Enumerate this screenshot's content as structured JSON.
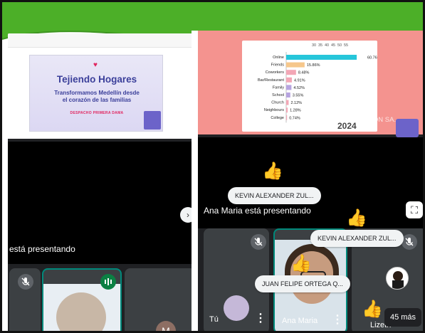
{
  "colors": {
    "banner_green": "#4caf28",
    "meet_dark": "#202124",
    "tile": "#3c4043",
    "active_border": "#00897b",
    "pink": "#f4938f",
    "chart_bar": "#26c6da"
  },
  "left_panel": {
    "slide": {
      "heart": "♥",
      "title": "Tejiendo Hogares",
      "subtitle_line1": "Transformamos Medellín desde",
      "subtitle_line2": "el corazón de las familias",
      "office": "DESPACHO PRIMERA DAMA"
    },
    "presenting_text": "está presentando",
    "avatar_letter": "M"
  },
  "right_panel": {
    "chart": {
      "axis_ticks": [
        "30",
        "35",
        "40",
        "45",
        "50",
        "55"
      ],
      "year": "2024"
    },
    "self_view_name": "SAMUEL CALDERÓN SA...",
    "reaction_names": {
      "top": "KEVIN ALEXANDER ZUL...",
      "middle": "KEVIN ALEXANDER ZUL...",
      "bottom": "JUAN FELIPE ORTEGA Q..."
    },
    "presenting_text": "Ana Maria está presentando",
    "tiles": {
      "you": "Tú",
      "ana": "Ana Maria",
      "third": "Lizeth"
    },
    "more_count": "45 más"
  },
  "icons": {
    "mic_off": "mic-off-icon",
    "speaking": "speaking-indicator-icon",
    "thumbs_up": "👍",
    "fullscreen": "fullscreen-icon",
    "more": "more-vert-icon"
  },
  "chart_data": {
    "type": "bar",
    "categories": [
      "Online",
      "Friends",
      "Coworkers",
      "Bar/Restaurant",
      "Family",
      "School",
      "Church",
      "Neighbours",
      "College"
    ],
    "values": [
      60.76,
      15.86,
      8.48,
      4.91,
      4.52,
      3.55,
      2.12,
      1.28,
      0.74
    ],
    "value_labels": [
      "60.76%",
      "15.86%",
      "8.48%",
      "4.91%",
      "4.52%",
      "3.55%",
      "2.12%",
      "1.28%",
      "0.74%"
    ],
    "title": "2024",
    "xlabel": "",
    "ylabel": "",
    "xlim": [
      0,
      65
    ],
    "grid": false
  }
}
